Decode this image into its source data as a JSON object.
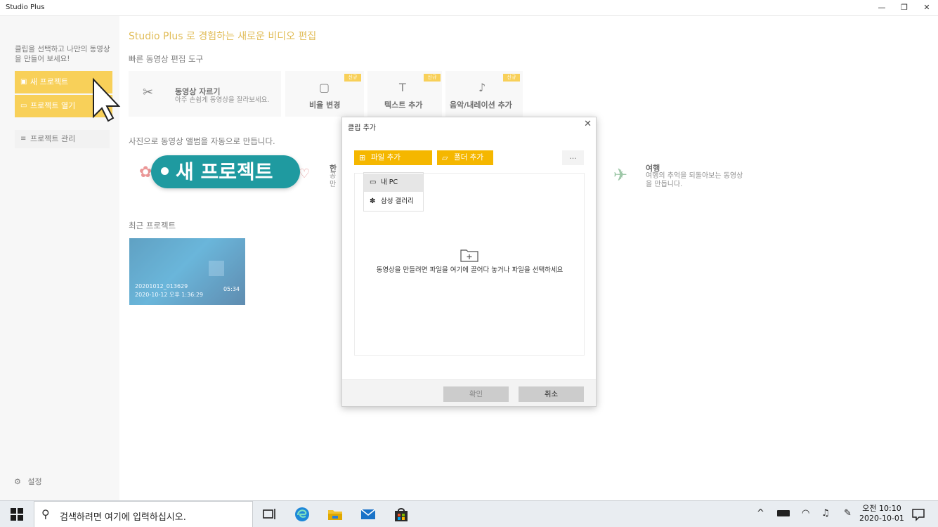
{
  "window": {
    "title": "Studio Plus",
    "minimize": "—",
    "maximize": "❐",
    "close": "✕"
  },
  "sidebar": {
    "intro": "클립을 선택하고 나만의 동영상을 만들어 보세요!",
    "new_project": "새 프로젝트",
    "open_project": "프로젝트 열기",
    "manage_projects": "프로젝트 관리",
    "settings": "설정"
  },
  "main": {
    "title": "Studio Plus 로 경험하는 새로운 비디오 편집",
    "quick_tools_heading": "빠른 동영상 편집 도구",
    "tools": {
      "trim": {
        "name": "동영상 자르기",
        "desc": "아주 손쉽게 동영상을 잘라보세요."
      },
      "ratio": {
        "name": "비율 변경"
      },
      "text": {
        "name": "텍스트 추가"
      },
      "music": {
        "name": "음악/내레이션 추가"
      }
    },
    "badge": "신규",
    "album_heading": "사진으로 동영상 앨범을 자동으로 만듭니다.",
    "album": {
      "partial_title": "한",
      "partial_desc_1": "공",
      "partial_desc_2": "만",
      "travel_title": "여행",
      "travel_desc": "여행의 추억을 되돌아보는 동영상을 만듭니다."
    },
    "recent_heading": "최근 프로젝트",
    "recent": {
      "name": "20201012_013629",
      "date": "2020-10-12 오후 1:36:29",
      "duration": "05:34"
    }
  },
  "tutorial": {
    "label": "새 프로젝트"
  },
  "dialog": {
    "title": "클립 추가",
    "add_file": "파일 추가",
    "add_folder": "폴더 추가",
    "more": "...",
    "menu": [
      "내 PC",
      "삼성 갤러리"
    ],
    "drop_hint": "동영상을 만들려면 파일을 여기에 끌어다 놓거나 파일을 선택하세요",
    "ok": "확인",
    "cancel": "취소"
  },
  "taskbar": {
    "search_placeholder": "검색하려면 여기에 입력하십시오.",
    "time": "오전 10:10",
    "date": "2020-10-01"
  },
  "colors": {
    "accent": "#f5b700",
    "tutorial": "#1f9aa0"
  }
}
